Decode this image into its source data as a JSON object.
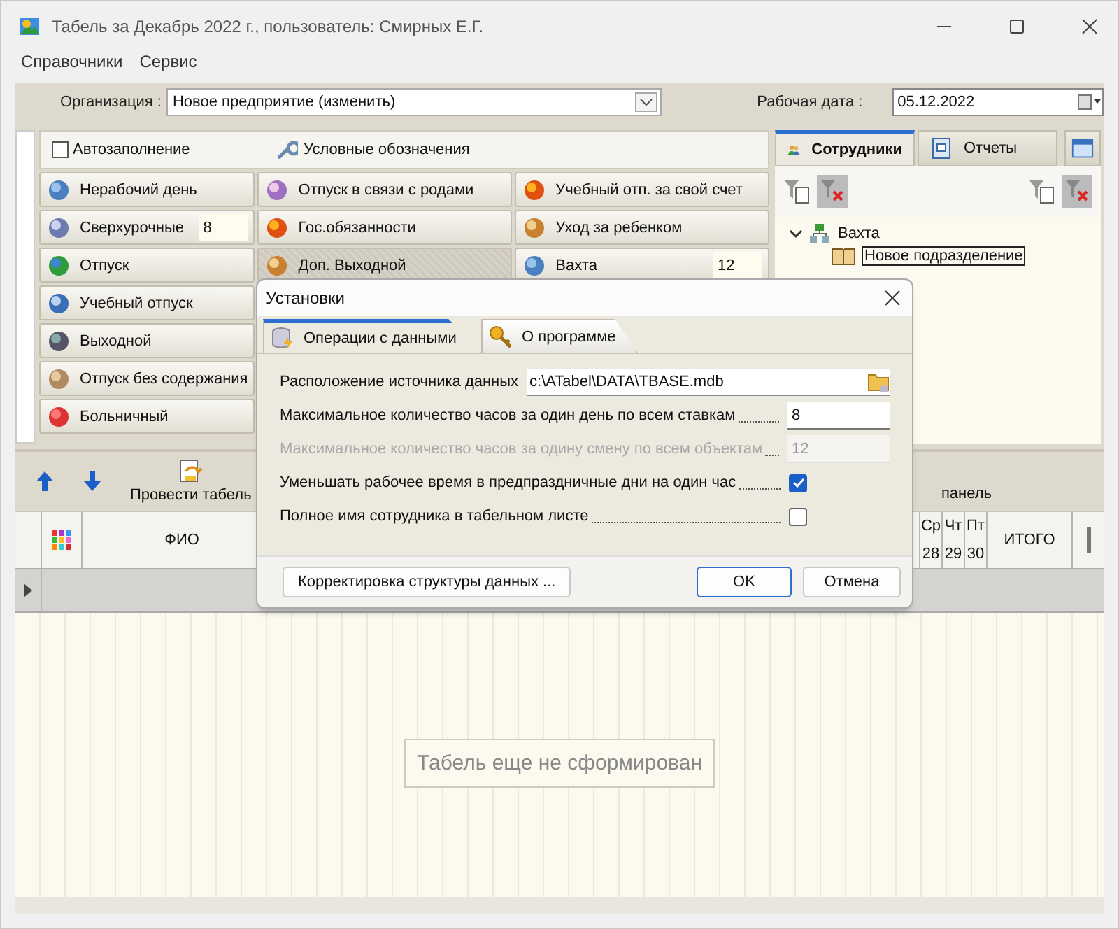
{
  "window": {
    "title": "Табель за Декабрь 2022 г., пользователь: Смирных Е.Г."
  },
  "menu": [
    "Справочники",
    "Сервис"
  ],
  "organization": {
    "label": "Организация :",
    "value": "Новое предприятие (изменить)"
  },
  "work_date": {
    "label": "Рабочая дата :",
    "value": "05.12.2022"
  },
  "autofill": {
    "label": "Автозаполнение",
    "checked": false
  },
  "legend_button": "Условные обозначения",
  "mark_columns": [
    [
      {
        "label": "Нерабочий день",
        "selected": false
      },
      {
        "label": "Сверхурочные",
        "value": "8",
        "selected": false
      },
      {
        "label": "Отпуск",
        "selected": false
      },
      {
        "label": "Учебный отпуск",
        "selected": false
      },
      {
        "label": "Выходной",
        "selected": false
      },
      {
        "label": "Отпуск без содержания",
        "selected": false
      },
      {
        "label": "Больничный",
        "selected": false
      }
    ],
    [
      {
        "label": "Отпуск в связи с родами",
        "selected": false
      },
      {
        "label": "Гос.обязанности",
        "selected": false
      },
      {
        "label": "Доп. Выходной",
        "selected": true
      }
    ],
    [
      {
        "label": "Учебный отп. за свой счет",
        "selected": false
      },
      {
        "label": "Уход за ребенком",
        "selected": false
      },
      {
        "label": "Вахта",
        "value": "12",
        "selected": false
      }
    ]
  ],
  "side_tabs": [
    {
      "label": "Сотрудники",
      "selected": true
    },
    {
      "label": "Отчеты",
      "selected": false
    }
  ],
  "tree": [
    {
      "label": "Вахта",
      "expanded": true,
      "children": [
        {
          "label": "Новое подразделение",
          "selected": true
        }
      ]
    }
  ],
  "toolbar": {
    "post_button": "Провести табель",
    "panel_button": "панель"
  },
  "grid": {
    "name_column": "ФИО",
    "days": [
      {
        "weekday": "Ср",
        "day": "28"
      },
      {
        "weekday": "Чт",
        "day": "29"
      },
      {
        "weekday": "Пт",
        "day": "30"
      }
    ],
    "total_column": "ИТОГО",
    "empty_message": "Табель еще не сформирован"
  },
  "dialog": {
    "title": "Установки",
    "tabs": [
      {
        "label": "Операции с данными",
        "selected": true
      },
      {
        "label": "О программе",
        "selected": false
      }
    ],
    "fields": [
      {
        "kind": "path",
        "label": "Расположение источника данных",
        "value": "c:\\ATabel\\DATA\\TBASE.mdb"
      },
      {
        "kind": "number",
        "label": "Максимальное количество часов за один день по всем ставкам",
        "value": "8",
        "disabled": false
      },
      {
        "kind": "number",
        "label": "Максимальное количество часов за одину смену по всем объектам",
        "value": "12",
        "disabled": true
      },
      {
        "kind": "check",
        "label": "Уменьшать рабочее время в предпраздничные дни на один час",
        "checked": true
      },
      {
        "kind": "check",
        "label": "Полное имя сотрудника в табельном листе",
        "checked": false
      }
    ],
    "buttons": {
      "repair": "Корректировка структуры данных ...",
      "ok": "OK",
      "cancel": "Отмена"
    }
  }
}
